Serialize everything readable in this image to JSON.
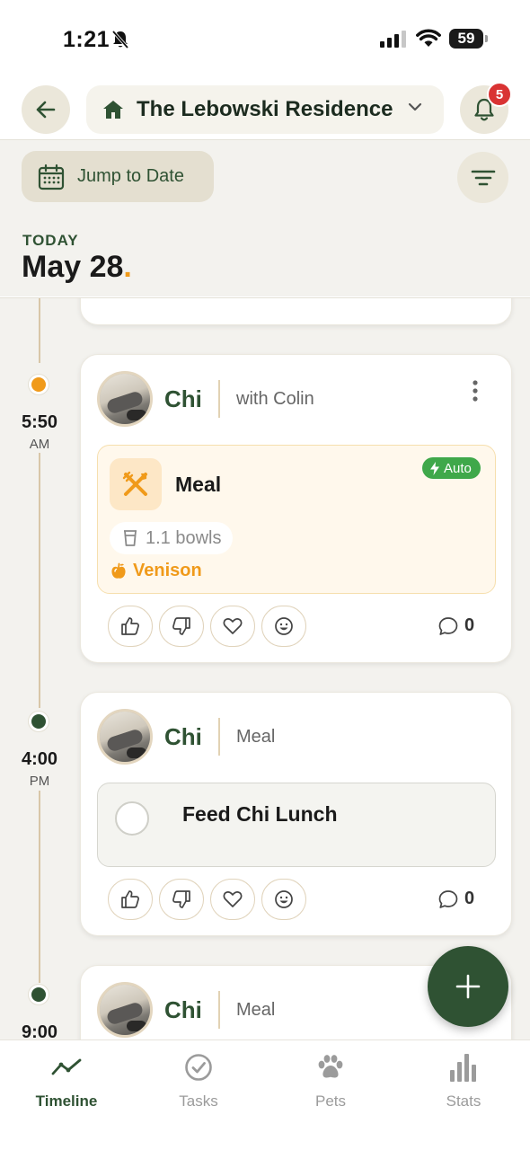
{
  "status_bar": {
    "time": "1:21",
    "battery": "59"
  },
  "header": {
    "home_name": "The Lebowski Residence",
    "notification_count": "5",
    "jump_label": "Jump to Date",
    "today_label": "TODAY",
    "date": "May 28",
    "date_dot": "."
  },
  "timeline": [
    {
      "time": "5:50",
      "ampm": "AM",
      "pet": "Chi",
      "subtitle": "with Colin",
      "activity": {
        "title": "Meal",
        "badge": "Auto",
        "amount": "1.1 bowls",
        "food": "Venison"
      },
      "comments": "0"
    },
    {
      "time": "4:00",
      "ampm": "PM",
      "pet": "Chi",
      "subtitle": "Meal",
      "task": "Feed Chi Lunch",
      "comments": "0"
    },
    {
      "time": "9:00",
      "pet": "Chi",
      "subtitle": "Meal"
    }
  ],
  "tabs": [
    {
      "label": "Timeline",
      "icon": "timeline-icon"
    },
    {
      "label": "Tasks",
      "icon": "check-circle-icon"
    },
    {
      "label": "Pets",
      "icon": "paw-icon"
    },
    {
      "label": "Stats",
      "icon": "bar-chart-icon"
    }
  ],
  "colors": {
    "primary_green": "#2f5233",
    "accent_orange": "#f09a1a",
    "background": "#f3f2ee",
    "badge_red": "#d93333",
    "auto_green": "#3fa84a"
  }
}
